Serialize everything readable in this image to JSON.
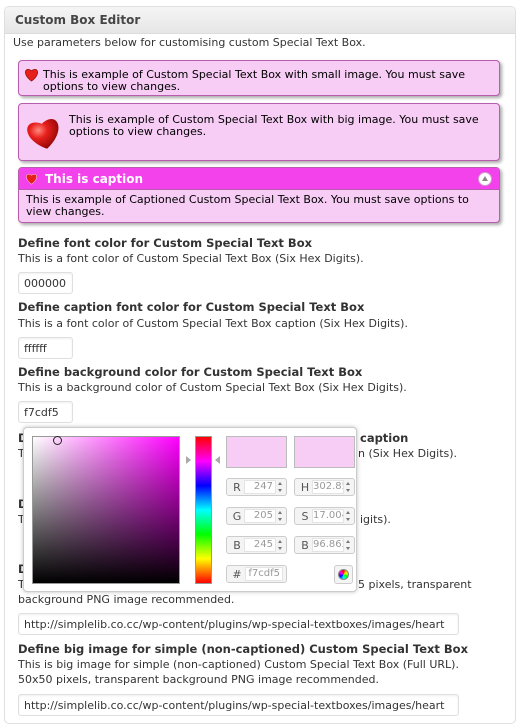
{
  "panel": {
    "title": "Custom Box Editor",
    "intro": "Use parameters below for customising custom Special Text Box."
  },
  "previews": {
    "small_image_text": "This is example of Custom Special Text Box with small image. You must save options to view changes.",
    "big_image_text": "This is example of Custom Special Text Box with big image. You must save options to view changes.",
    "caption": "This is caption",
    "captioned_text": "This is example of Captioned Custom Special Text Box. You must save options to view changes.",
    "background_color": "#f7cdf5",
    "border_color": "#b85dad",
    "caption_bg_color": "#f341ec"
  },
  "fields": [
    {
      "label": "Define font color for Custom Special Text Box",
      "desc": "This is a font color of Custom Special Text Box (Six Hex Digits).",
      "value": "000000"
    },
    {
      "label": "Define caption font color for Custom Special Text Box",
      "desc": "This is a font color of Custom Special Text Box caption (Six Hex Digits).",
      "value": "ffffff"
    },
    {
      "label": "Define background color for Custom Special Text Box",
      "desc": "This is a background color of Custom Special Text Box (Six Hex Digits).",
      "value": "f7cdf5"
    },
    {
      "label_visible": "caption",
      "desc_visible": "n (Six Hex Digits)."
    },
    {
      "label_visible": "D",
      "desc_visible_left": "T",
      "desc_visible_right": "igits)."
    },
    {
      "label_visible": "D",
      "desc_visible_left": "T",
      "desc_visible_right": "5 pixels, transparent",
      "desc_line2": "background PNG image recommended.",
      "value": "http://simplelib.co.cc/wp-content/plugins/wp-special-textboxes/images/heart"
    },
    {
      "label": "Define big image for simple (non-captioned) Custom Special Text Box",
      "desc_line1": "This is big image for simple (non-captioned) Custom Special Text Box (Full URL).",
      "desc_line2": "50x50 pixels, transparent background PNG image recommended.",
      "value": "http://simplelib.co.cc/wp-content/plugins/wp-special-textboxes/images/heart"
    }
  ],
  "color_picker": {
    "new_color": "#f7cdf5",
    "current_color": "#f7cdf5",
    "selected_hue": "#ff00ff",
    "saturation": 0.17,
    "brightness": 0.97,
    "inputs": {
      "r": {
        "key": "R",
        "value": "247"
      },
      "g": {
        "key": "G",
        "value": "205"
      },
      "b": {
        "key": "B",
        "value": "245"
      },
      "h": {
        "key": "H",
        "value": "302.85"
      },
      "s": {
        "key": "S",
        "value": "17.004"
      },
      "bv": {
        "key": "B",
        "value": "96.862"
      },
      "hex": {
        "key": "#",
        "value": "f7cdf5"
      }
    },
    "icons": [
      "color-wheel-icon"
    ]
  }
}
